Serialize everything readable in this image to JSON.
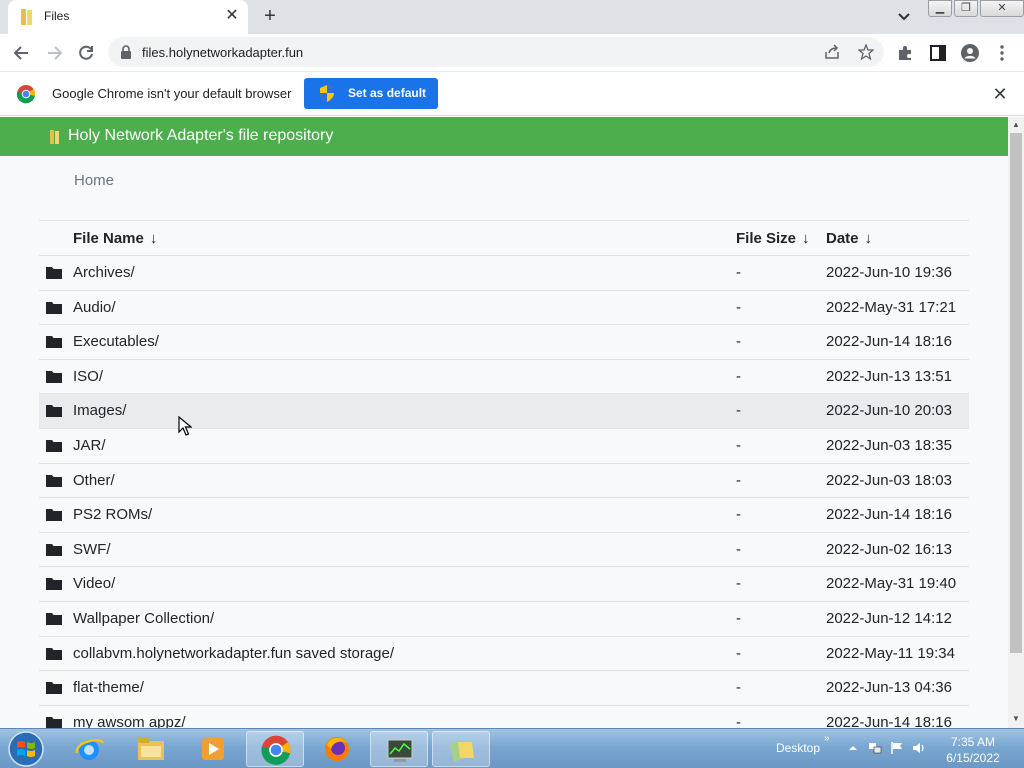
{
  "browser": {
    "tab_title": "Files",
    "url": "files.holynetworkadapter.fun",
    "new_tab_symbol": "+",
    "tab_close_symbol": "✕"
  },
  "infobar": {
    "message": "Google Chrome isn't your default browser",
    "button_label": "Set as default",
    "close_symbol": "✕"
  },
  "site": {
    "title": "Holy Network Adapter's file repository",
    "breadcrumb": "Home",
    "header_color": "#4cae4c"
  },
  "table": {
    "columns": [
      {
        "label": "File Name",
        "arrow": "↓"
      },
      {
        "label": "File Size",
        "arrow": "↓"
      },
      {
        "label": "Date",
        "arrow": "↓"
      }
    ],
    "rows": [
      {
        "name": "Archives/",
        "size": "-",
        "date": "2022-Jun-10 19:36"
      },
      {
        "name": "Audio/",
        "size": "-",
        "date": "2022-May-31 17:21"
      },
      {
        "name": "Executables/",
        "size": "-",
        "date": "2022-Jun-14 18:16"
      },
      {
        "name": "ISO/",
        "size": "-",
        "date": "2022-Jun-13 13:51"
      },
      {
        "name": "Images/",
        "size": "-",
        "date": "2022-Jun-10 20:03"
      },
      {
        "name": "JAR/",
        "size": "-",
        "date": "2022-Jun-03 18:35"
      },
      {
        "name": "Other/",
        "size": "-",
        "date": "2022-Jun-03 18:03"
      },
      {
        "name": "PS2 ROMs/",
        "size": "-",
        "date": "2022-Jun-14 18:16"
      },
      {
        "name": "SWF/",
        "size": "-",
        "date": "2022-Jun-02 16:13"
      },
      {
        "name": "Video/",
        "size": "-",
        "date": "2022-May-31 19:40"
      },
      {
        "name": "Wallpaper Collection/",
        "size": "-",
        "date": "2022-Jun-12 14:12"
      },
      {
        "name": "collabvm.holynetworkadapter.fun saved storage/",
        "size": "-",
        "date": "2022-May-11 19:34"
      },
      {
        "name": "flat-theme/",
        "size": "-",
        "date": "2022-Jun-13 04:36"
      },
      {
        "name": "my awsom appz/",
        "size": "-",
        "date": "2022-Jun-14 18:16"
      }
    ]
  },
  "taskbar": {
    "desktop_label": "Desktop",
    "time": "7:35 AM",
    "date": "6/15/2022"
  }
}
